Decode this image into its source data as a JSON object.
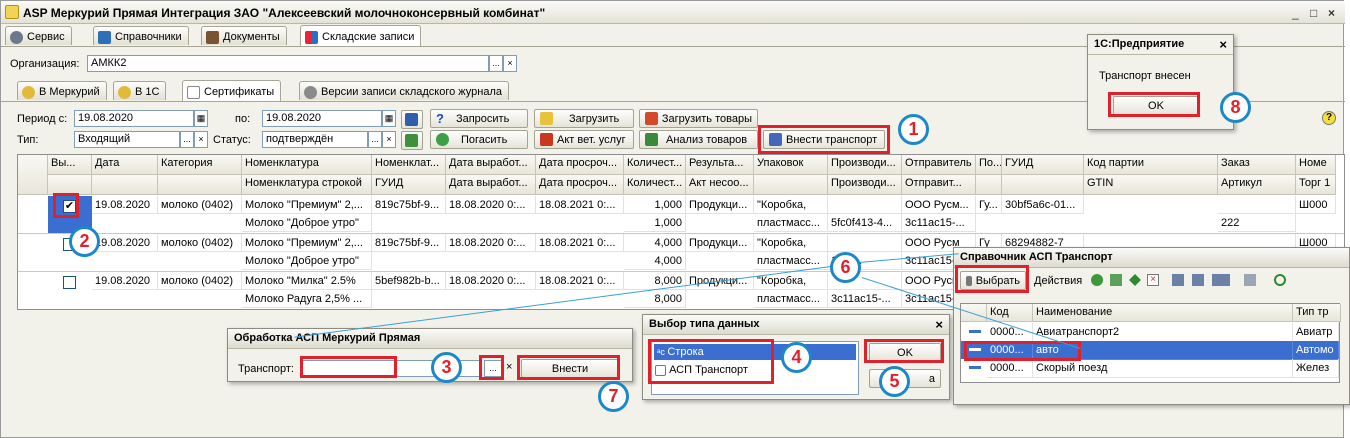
{
  "app": {
    "title": "ASP Меркурий Прямая Интеграция ЗАО \"Алексеевский молочноконсервный комбинат\"",
    "window_controls": [
      "_",
      "□",
      "×"
    ]
  },
  "main_tabs": [
    "Сервис",
    "Справочники",
    "Документы",
    "Складские записи"
  ],
  "org": {
    "label": "Организация:",
    "value": "АМКК2",
    "btn": "...",
    "clear": "×"
  },
  "sub_tabs": [
    "В Меркурий",
    "В 1С",
    "Сертификаты",
    "Версии записи складского журнала"
  ],
  "filters": {
    "period_label": "Период с:",
    "period_from": "19.08.2020",
    "period_to_label": "по:",
    "period_to": "19.08.2020",
    "type_label": "Тип:",
    "type_value": "Входящий",
    "status_label": "Статус:",
    "status_value": "подтверждён",
    "cal_icon": "▦",
    "dots": "...",
    "clear": "×"
  },
  "toolbar": {
    "request": "Запросить",
    "load": "Загрузить",
    "load_goods": "Загрузить товары",
    "extinguish": "Погасить",
    "vet_act": "Акт вет. услуг",
    "goods_analysis": "Анализ товаров",
    "add_transport": "Внести транспорт"
  },
  "help_icon": "?",
  "table": {
    "headers_top": [
      "Вы...",
      "Дата",
      "Категория",
      "Номенклатура",
      "Номенклат...",
      "Дата выработ...",
      "Дата просроч...",
      "Количест...",
      "Результа...",
      "Упаковок",
      "Производи...",
      "Отправитель",
      "По...",
      "ГУИД",
      "Код партии",
      "Заказ",
      "Номе"
    ],
    "headers_bottom": [
      "",
      "",
      "",
      "Номенклатура строкой",
      "ГУИД",
      "Дата выработ...",
      "Дата просроч...",
      "Количест...",
      "Акт несоо...",
      "",
      "Производи...",
      "Отправит...",
      "",
      "",
      "GTIN",
      "Артикул",
      "Торг 1"
    ],
    "rows": [
      {
        "checked": true,
        "date": "19.08.2020",
        "category": "молоко (0402)",
        "nom1": "Молоко \"Премиум\" 2,...",
        "nom2": "Молоко \"Доброе утро\"",
        "guid": "819c75bf-9...",
        "made": "18.08.2020 0:...",
        "expire": "18.08.2021 0:...",
        "qty1": "1,000",
        "qty2": "1,000",
        "result": "Продукци...",
        "pack1": "\"Коробка,",
        "pack2": "пластмасс...",
        "prod1": "",
        "prod2": "5fc0f413-4...",
        "sender1": "ООО Русм...",
        "sender2": "3c11ac15-...",
        "po": "Гу...",
        "guid2": "30bf5a6c-01...",
        "order": "",
        "order2": "222",
        "nom_last": "Ш000"
      },
      {
        "checked": false,
        "date": "19.08.2020",
        "category": "молоко (0402)",
        "nom1": "Молоко \"Премиум\" 2,...",
        "nom2": "Молоко \"Доброе утро\"",
        "guid": "819c75bf-9...",
        "made": "18.08.2020 0:...",
        "expire": "18.08.2021 0:...",
        "qty1": "4,000",
        "qty2": "4,000",
        "result": "Продукци...",
        "pack1": "\"Коробка,",
        "pack2": "пластмасс...",
        "prod1": "",
        "prod2": "13-4...",
        "sender1": "ООО Русм",
        "sender2": "3c11ac15-...",
        "po": "Гу",
        "guid2": "68294882-7",
        "order": "",
        "order2": "",
        "nom_last": "Ш000"
      },
      {
        "checked": false,
        "date": "19.08.2020",
        "category": "молоко (0402)",
        "nom1": "Молоко \"Милка\" 2.5%",
        "nom2": "Молоко Радуга 2,5% ...",
        "guid": "5bef982b-b...",
        "made": "18.08.2020 0:...",
        "expire": "18.08.2021 0:...",
        "qty1": "8,000",
        "qty2": "8,000",
        "result": "Продукци...",
        "pack1": "\"Коробка,",
        "pack2": "пластмасс...",
        "prod1": "",
        "prod2": "3c11ac15-...",
        "sender1": "ООО Русм...",
        "sender2": "3c11ac15-...",
        "po": "",
        "guid2": "",
        "order": "",
        "order2": "",
        "nom_last": ""
      }
    ]
  },
  "dlg_obr": {
    "title": "Обработка  АСП Меркурий Прямая",
    "transport_label": "Транспорт:",
    "value": "",
    "dots": "...",
    "clear": "×",
    "submit": "Внести"
  },
  "dlg_type": {
    "title": "Выбор типа данных",
    "options": [
      "Строка",
      "АСП Транспорт"
    ],
    "ok": "OK",
    "cancel": "Отмена",
    "cancel_visible": "а"
  },
  "dlg_sprav": {
    "title": "Справочник АСП Транспорт",
    "select": "Выбрать",
    "actions": "Действия",
    "col_code": "Код",
    "col_name": "Наименование",
    "col_type": "Тип тр",
    "rows": [
      {
        "code": "0000...",
        "name": "Авиатранспорт2",
        "type": "Авиатр"
      },
      {
        "code": "0000...",
        "name": "авто",
        "type": "Автомо"
      },
      {
        "code": "0000...",
        "name": "Скорый поезд",
        "type": "Желез"
      }
    ]
  },
  "dlg_msg": {
    "title": "1С:Предприятие",
    "text": "Транспорт внесен",
    "ok": "OK"
  },
  "badges": [
    "1",
    "2",
    "3",
    "4",
    "5",
    "6",
    "7",
    "8"
  ],
  "close": "×",
  "colors": {
    "red": "#e0202a",
    "badge_border": "#1b88c9",
    "selected_row": "#3a6fd1"
  }
}
